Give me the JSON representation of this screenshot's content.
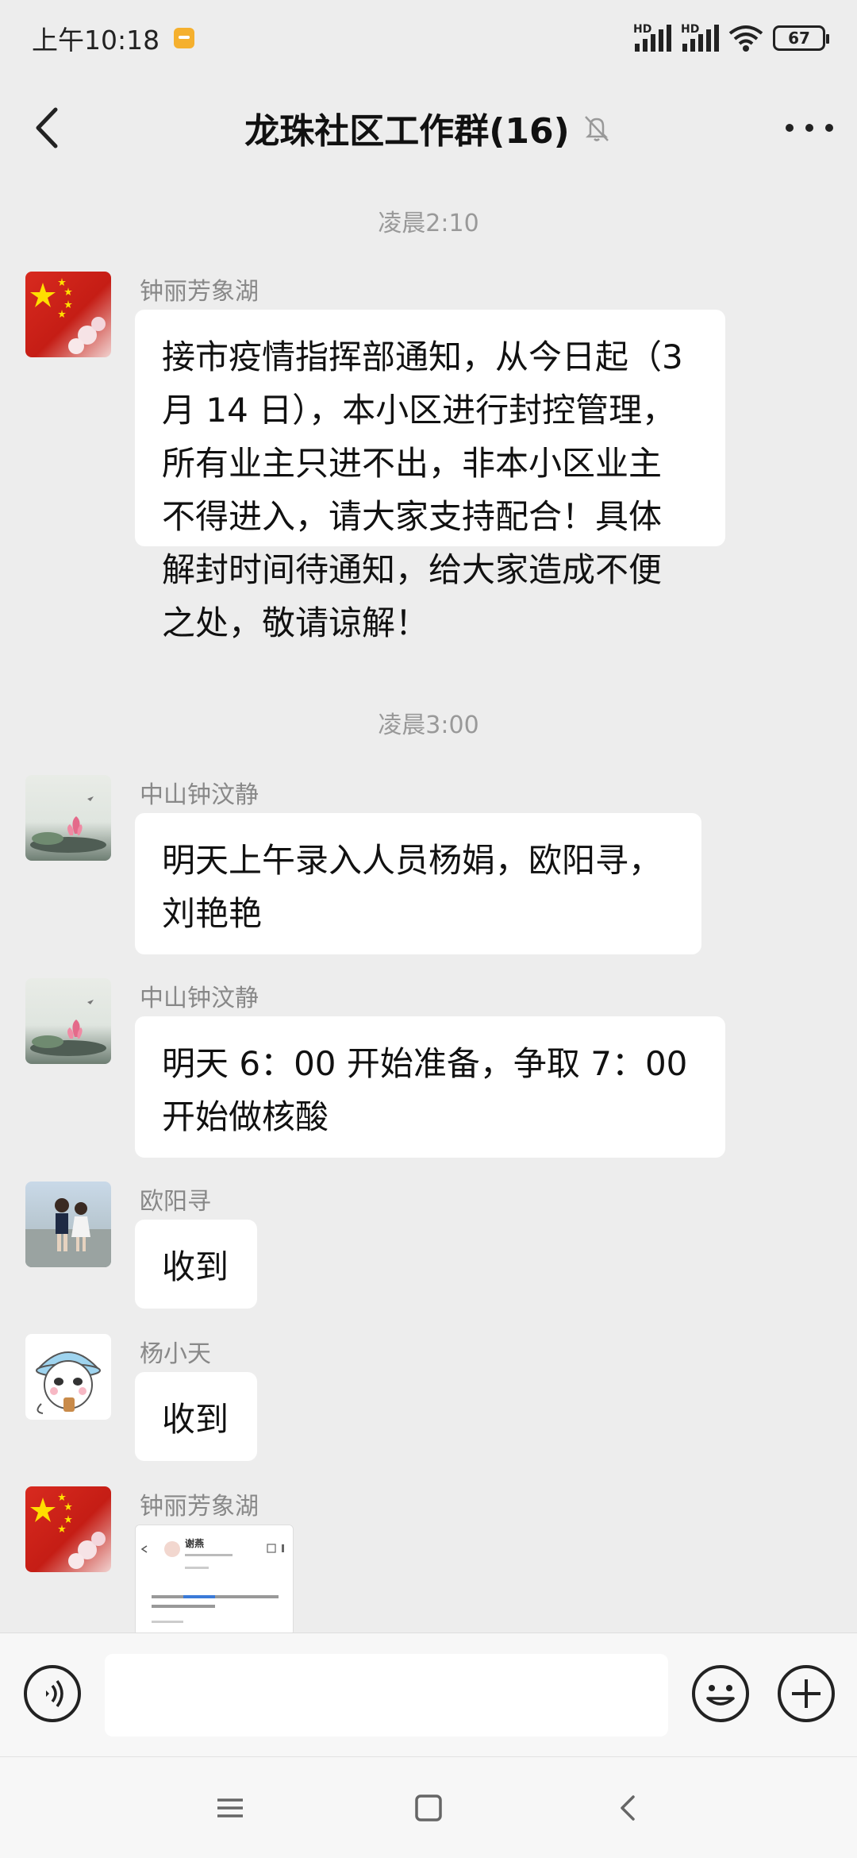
{
  "status_bar": {
    "time": "上午10:18",
    "battery": "67",
    "network_1": "HD",
    "network_2": "HD"
  },
  "header": {
    "title": "龙珠社区工作群(16)"
  },
  "chat": {
    "separators": [
      "凌晨2:10",
      "凌晨3:00"
    ],
    "messages": [
      {
        "sender": "钟丽芳象湖",
        "text": "接市疫情指挥部通知，从今日起（3\n月 14 日），本小区进行封控管理，\n所有业主只进不出，非本小区业主\n不得进入，请大家支持配合！具体\n解封时间待通知，给大家造成不便\n之处，敬请谅解！"
      },
      {
        "sender": "中山钟汶静",
        "text": "明天上午录入人员杨娟，欧阳寻，\n刘艳艳"
      },
      {
        "sender": "中山钟汶静",
        "text": "明天 6：00 开始准备，争取 7：00\n开始做核酸"
      },
      {
        "sender": "欧阳寻",
        "text": "收到"
      },
      {
        "sender": "杨小天",
        "text": "收到"
      },
      {
        "sender": "钟丽芳象湖",
        "image_caption": "谢燕"
      }
    ]
  },
  "input": {
    "value": "",
    "placeholder": ""
  },
  "icons": {
    "back": "back-arrow-icon",
    "mute": "mute-bell-icon",
    "more": "more-icon",
    "voice": "voice-icon",
    "emoji": "emoji-icon",
    "plus": "plus-icon"
  },
  "colors": {
    "background": "#ededed",
    "bubble": "#ffffff",
    "timestamp": "#999999"
  }
}
